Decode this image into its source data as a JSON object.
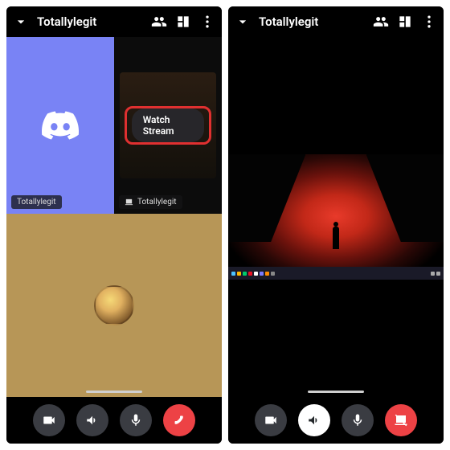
{
  "left": {
    "header": {
      "title": "Totallylegit"
    },
    "self_tile_name": "Totallylegit",
    "stream_tile_name": "Totallylegit",
    "watch_button": "Watch Stream"
  },
  "right": {
    "header": {
      "title": "Totallylegit"
    }
  },
  "colors": {
    "blurple": "#7983f5",
    "gold": "#b79657",
    "hangup_red": "#ed4245",
    "highlight_red": "#e03030"
  },
  "controls": {
    "video": "video-toggle",
    "audio_out": "speaker-toggle",
    "mic": "mic-toggle",
    "hangup": "disconnect",
    "stop_share": "stop-screenshare"
  }
}
